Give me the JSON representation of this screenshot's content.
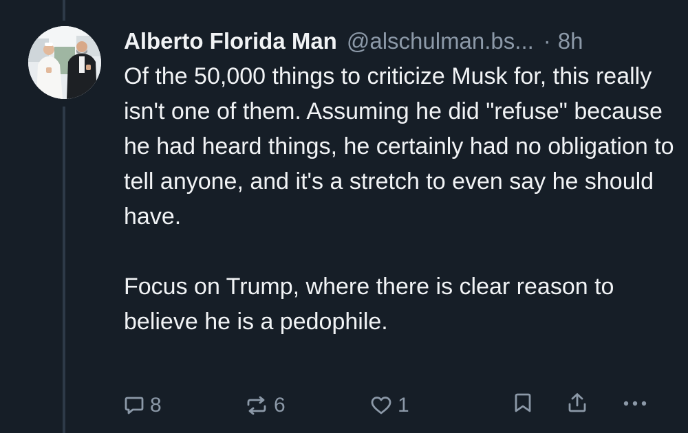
{
  "post": {
    "author_name": "Alberto Florida Man",
    "author_handle": "@alschulman.bs...",
    "separator": "·",
    "time_ago": "8h",
    "paragraphs": [
      "Of the 50,000 things to criticize Musk for, this really isn't one of them. Assuming he did \"refuse\" because he had heard things, he certainly had no obligation to tell anyone, and it's a stretch to even say he should have.",
      "Focus on Trump, where there is clear reason to believe he is a pedophile."
    ]
  },
  "actions": {
    "reply_count": "8",
    "repost_count": "6",
    "like_count": "1"
  },
  "icons": {
    "reply": "speech-bubble-icon",
    "repost": "repost-arrows-icon",
    "like": "heart-icon",
    "save": "bookmark-icon",
    "share": "share-upload-icon",
    "more": "ellipsis-icon"
  },
  "colors": {
    "background": "#161e27",
    "text": "#f1f3f5",
    "muted": "#8c99a8",
    "thread_line": "#2e3a48"
  }
}
